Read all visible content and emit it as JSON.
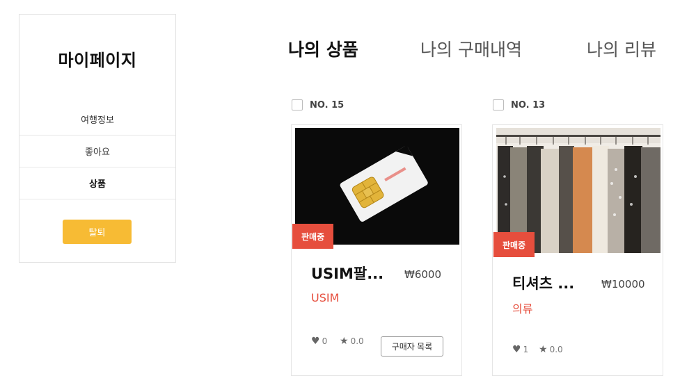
{
  "sidebar": {
    "title": "마이페이지",
    "items": [
      {
        "label": "여행정보"
      },
      {
        "label": "좋아요"
      },
      {
        "label": "상품"
      }
    ],
    "withdraw_label": "탈퇴"
  },
  "tabs": [
    {
      "label": "나의 상품",
      "active": true
    },
    {
      "label": "나의 구매내역",
      "active": false
    },
    {
      "label": "나의 리뷰",
      "active": false
    }
  ],
  "products": [
    {
      "number": "NO. 15",
      "status": "판매중",
      "name": "USIM팔...",
      "price": "₩6000",
      "category": "USIM",
      "likes": "0",
      "rating": "0.0",
      "buyers_button": "구매자 목록",
      "image_icon": "sim-card-image"
    },
    {
      "number": "NO. 13",
      "status": "판매중",
      "name": "티셔츠 ...",
      "price": "₩10000",
      "category": "의류",
      "likes": "1",
      "rating": "0.0",
      "image_icon": "clothes-rack-image"
    }
  ],
  "colors": {
    "accent_yellow": "#f7bb34",
    "status_red": "#e64e3d"
  }
}
